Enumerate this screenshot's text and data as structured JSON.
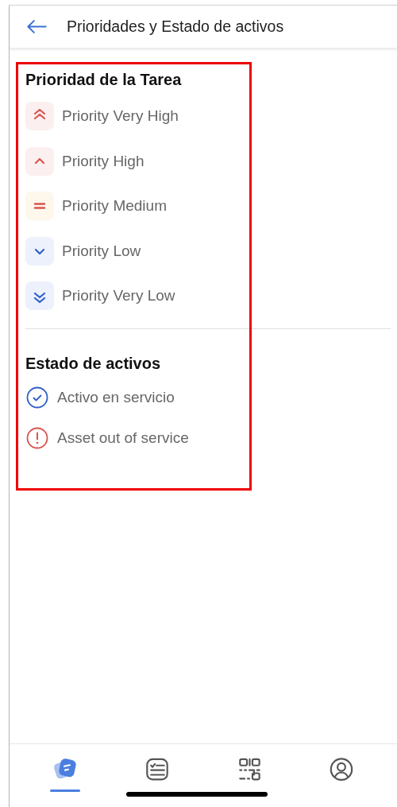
{
  "header": {
    "title": "Prioridades y Estado de activos"
  },
  "sections": [
    {
      "title": "Prioridad de la Tarea",
      "kind": "priority",
      "items": [
        {
          "label": "Priority Very High",
          "kind": "very_high"
        },
        {
          "label": "Priority High",
          "kind": "high"
        },
        {
          "label": "Priority Medium",
          "kind": "medium"
        },
        {
          "label": "Priority Low",
          "kind": "low"
        },
        {
          "label": "Priority Very Low",
          "kind": "very_low"
        }
      ]
    },
    {
      "title": "Estado de activos",
      "kind": "status",
      "items": [
        {
          "label": "Activo en servicio",
          "kind": "in_service"
        },
        {
          "label": "Asset out of service",
          "kind": "out_of_service"
        }
      ]
    }
  ],
  "annotation": {
    "kind": "frame"
  },
  "tabs": [
    {
      "kind": "home",
      "selected": true
    },
    {
      "kind": "checklist",
      "selected": false
    },
    {
      "kind": "qr",
      "selected": false
    },
    {
      "kind": "profile",
      "selected": false
    }
  ]
}
